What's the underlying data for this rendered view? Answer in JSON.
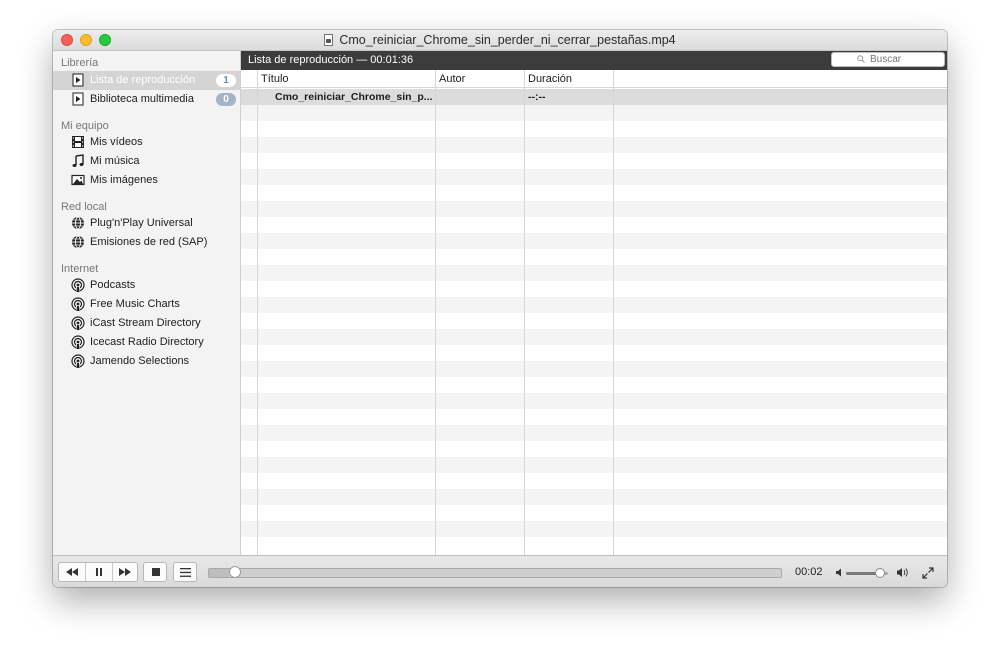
{
  "window": {
    "title": "Cmo_reiniciar_Chrome_sin_perder_ni_cerrar_pestañas.mp4"
  },
  "sidebar": {
    "sections": [
      {
        "title": "Librería",
        "items": [
          {
            "label": "Lista de reproducción",
            "badge": "1",
            "icon": "playlist-icon",
            "selected": true
          },
          {
            "label": "Biblioteca multimedia",
            "badge": "0",
            "icon": "media-library-icon"
          }
        ]
      },
      {
        "title": "Mi equipo",
        "items": [
          {
            "label": "Mis vídeos",
            "icon": "film-icon"
          },
          {
            "label": "Mi música",
            "icon": "music-note-icon"
          },
          {
            "label": "Mis imágenes",
            "icon": "picture-icon"
          }
        ]
      },
      {
        "title": "Red local",
        "items": [
          {
            "label": "Plug'n'Play Universal",
            "icon": "network-globe-icon"
          },
          {
            "label": "Emisiones de red (SAP)",
            "icon": "network-globe-icon"
          }
        ]
      },
      {
        "title": "Internet",
        "items": [
          {
            "label": "Podcasts",
            "icon": "podcast-icon"
          },
          {
            "label": "Free Music Charts",
            "icon": "podcast-icon"
          },
          {
            "label": "iCast Stream Directory",
            "icon": "podcast-icon"
          },
          {
            "label": "Icecast Radio Directory",
            "icon": "podcast-icon"
          },
          {
            "label": "Jamendo Selections",
            "icon": "podcast-icon"
          }
        ]
      }
    ]
  },
  "playlist": {
    "header": "Lista de reproducción — 00:01:36",
    "search_placeholder": "Buscar",
    "columns": [
      "Título",
      "Autor",
      "Duración"
    ],
    "rows": [
      {
        "title": "Cmo_reiniciar_Chrome_sin_p...",
        "author": "",
        "duration": "--:--"
      }
    ]
  },
  "controls": {
    "buttons": [
      "rewind-icon",
      "pause-icon",
      "fast-forward-icon",
      "stop-icon",
      "playlist-toggle-icon"
    ],
    "elapsed": "00:02",
    "progress_fraction": 0.035,
    "volume_fraction": 0.82
  },
  "colors": {
    "header_bar": "#3c3c3c",
    "badge_dark": "#a3b3c8",
    "badge_text": "#6d8fb8"
  }
}
